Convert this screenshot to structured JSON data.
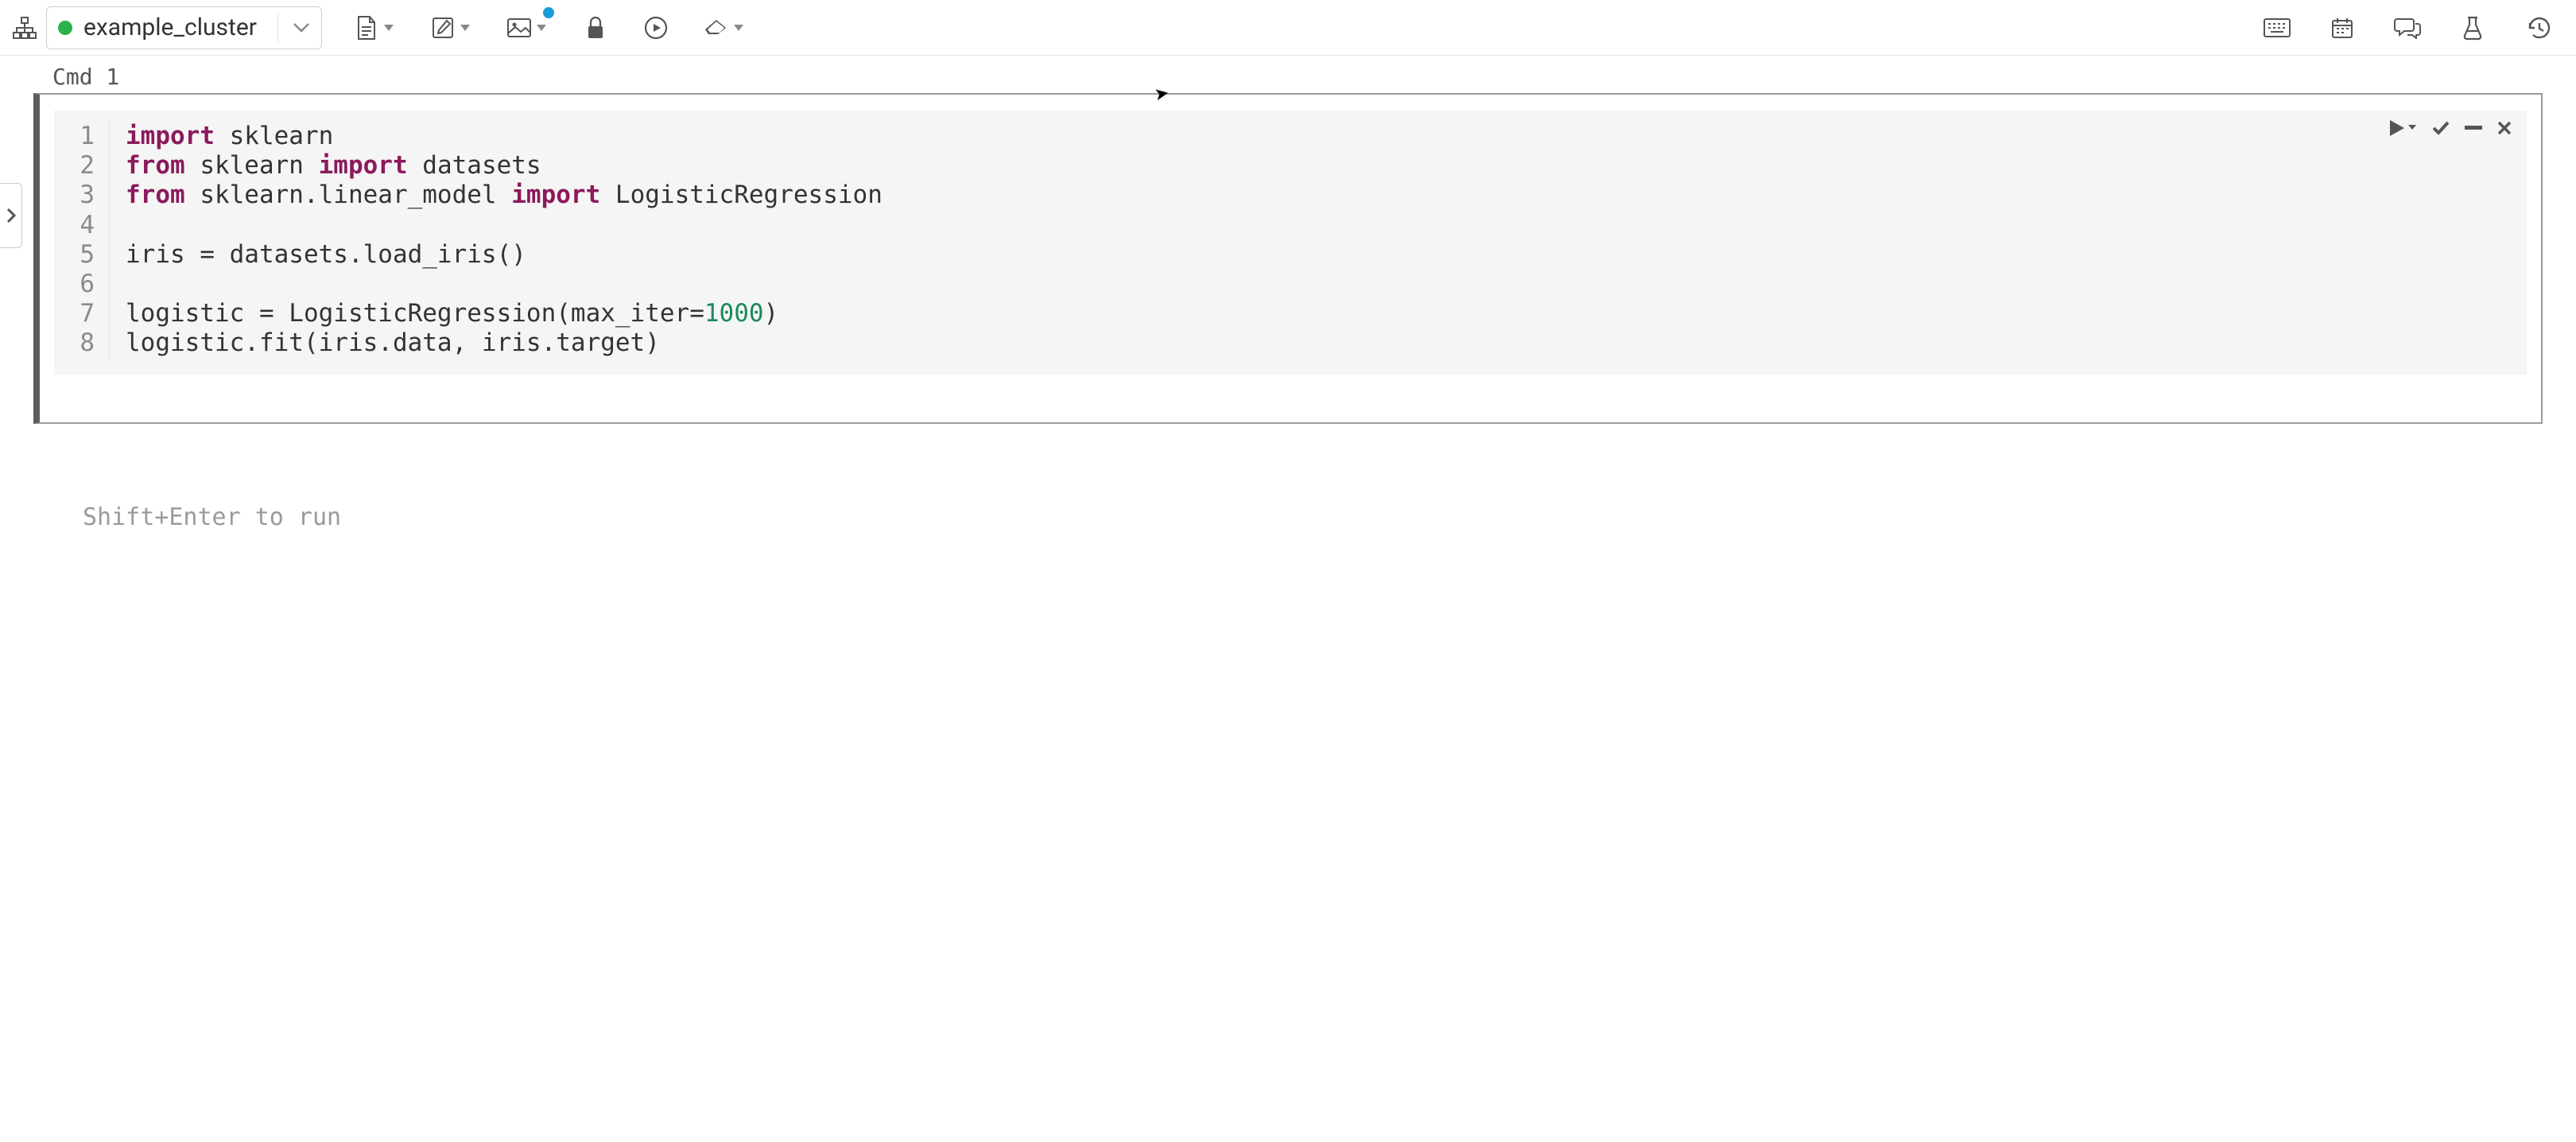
{
  "cluster": {
    "status": "running",
    "name": "example_cluster"
  },
  "toolbar": {
    "icons": {
      "sitemap": "sitemap-icon",
      "file": "file-icon",
      "edit": "edit-icon",
      "image": "image-icon",
      "lock": "lock-icon",
      "run_all": "play-circle-icon",
      "eraser": "eraser-icon",
      "keyboard": "keyboard-icon",
      "schedule": "calendar-icon",
      "comments": "comments-icon",
      "experiments": "flask-icon",
      "history": "history-icon"
    }
  },
  "cell": {
    "label": "Cmd 1",
    "actions": {
      "run": "run",
      "confirm": "confirm",
      "collapse": "collapse",
      "close": "close"
    },
    "code_lines": [
      {
        "n": "1",
        "segments": [
          {
            "t": "import",
            "c": "kw"
          },
          {
            "t": " sklearn"
          }
        ]
      },
      {
        "n": "2",
        "segments": [
          {
            "t": "from",
            "c": "kw"
          },
          {
            "t": " sklearn "
          },
          {
            "t": "import",
            "c": "kw"
          },
          {
            "t": " datasets"
          }
        ]
      },
      {
        "n": "3",
        "segments": [
          {
            "t": "from",
            "c": "kw"
          },
          {
            "t": " sklearn.linear_model "
          },
          {
            "t": "import",
            "c": "kw"
          },
          {
            "t": " LogisticRegression"
          }
        ]
      },
      {
        "n": "4",
        "segments": [
          {
            "t": ""
          }
        ]
      },
      {
        "n": "5",
        "segments": [
          {
            "t": "iris = datasets.load_iris()"
          }
        ]
      },
      {
        "n": "6",
        "segments": [
          {
            "t": ""
          }
        ]
      },
      {
        "n": "7",
        "segments": [
          {
            "t": "logistic = LogisticRegression(max_iter="
          },
          {
            "t": "1000",
            "c": "num"
          },
          {
            "t": ")"
          }
        ]
      },
      {
        "n": "8",
        "segments": [
          {
            "t": "logistic.fit(iris.data, iris.target)"
          }
        ]
      }
    ]
  },
  "hint": "Shift+Enter to run"
}
